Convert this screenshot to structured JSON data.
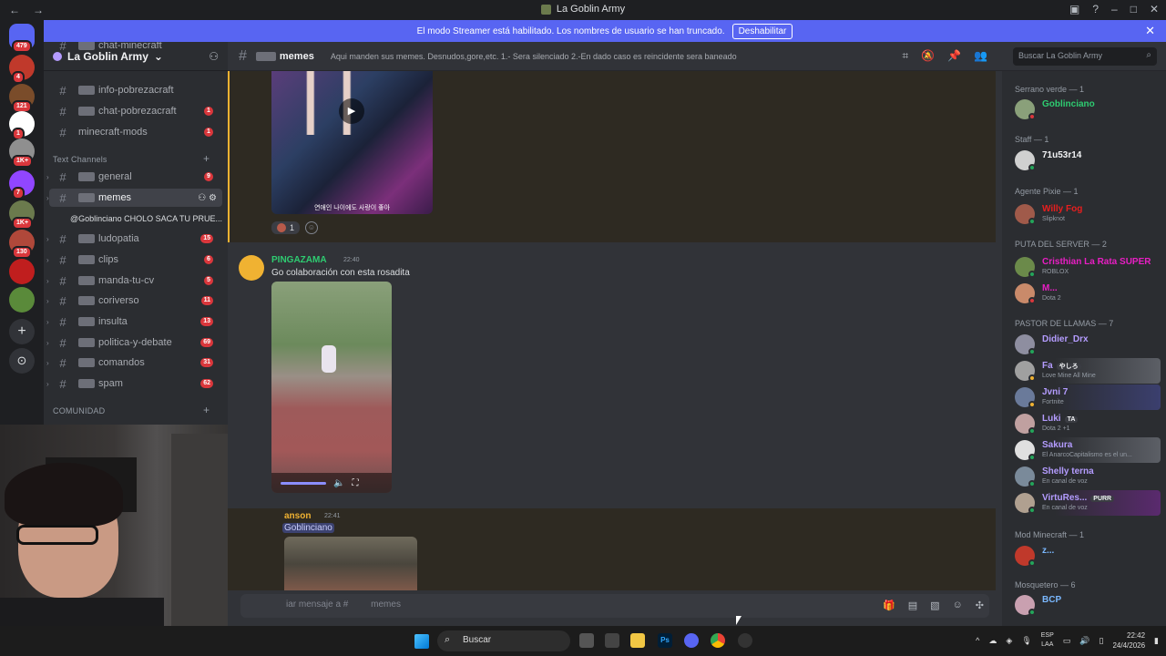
{
  "window": {
    "title": "La Goblin Army"
  },
  "servers": [
    {
      "badge": "479",
      "color": "#5865f2"
    },
    {
      "badge": "4",
      "color": "#c0392b"
    },
    {
      "badge": "121",
      "color": "#7a4c2a"
    },
    {
      "badge": "1",
      "color": "#ffffff"
    },
    {
      "badge": "1K+",
      "color": "#8f8f8f"
    },
    {
      "badge": "7",
      "color": "#9146ff"
    },
    {
      "badge": "1K+",
      "color": "#6b7a4d"
    },
    {
      "badge": "130",
      "color": "#b0483a"
    },
    {
      "badge": "",
      "color": "#c01e1e"
    },
    {
      "badge": "",
      "color": "#5a8a3a"
    }
  ],
  "banner": {
    "text": "El modo Streamer está habilitado. Los nombres de usuario se han truncado.",
    "button": "Deshabilitar"
  },
  "guild": {
    "name": "La Goblin Army"
  },
  "channels": {
    "top": [
      {
        "name": "chat-minecraft",
        "count": ""
      },
      {
        "name": "info-pobrezacraft",
        "count": ""
      },
      {
        "name": "chat-pobrezacraft",
        "count": "1"
      },
      {
        "name": "minecraft-mods",
        "count": "1"
      }
    ],
    "text_category": "Text Channels",
    "text": [
      {
        "name": "general",
        "count": "9"
      },
      {
        "name": "memes",
        "count": ""
      },
      {
        "name": "ludopatia",
        "count": "15"
      },
      {
        "name": "clips",
        "count": "6"
      },
      {
        "name": "manda-tu-cv",
        "count": "5"
      },
      {
        "name": "coriverso",
        "count": "11"
      },
      {
        "name": "insulta",
        "count": "13"
      },
      {
        "name": "politica-y-debate",
        "count": "69"
      },
      {
        "name": "comandos",
        "count": "31"
      },
      {
        "name": "spam",
        "count": "62"
      }
    ],
    "thread": "@Goblinciano CHOLO SACA TU PRUE...",
    "community_category": "COMUNIDAD"
  },
  "header": {
    "channel": "memes",
    "topic": "Aqui manden sus memes. Desnudos,gore,etc. 1.- Sera silenciado 2.-En dado caso es reincidente sera baneado",
    "search_placeholder": "Buscar La Goblin Army"
  },
  "messages": {
    "video_caption": "연애인 나이에도 사랑이 좋아",
    "reaction_count": "1",
    "msg2": {
      "author": "PINGAZAMA",
      "time": "22:40",
      "text": "Go colaboración con esta rosadita"
    },
    "msg3": {
      "author": "anson",
      "time": "22:41",
      "mention": "Goblinciano"
    }
  },
  "composer": {
    "placeholder": "iar mensaje a #",
    "channel": "memes"
  },
  "members": {
    "groups": [
      {
        "title": "Serrano verde — 1"
      },
      {
        "title": "Staff — 1"
      },
      {
        "title": "Agente Pixie — 1"
      },
      {
        "title": "PUTA DEL SERVER — 2"
      },
      {
        "title": "PASTOR DE LLAMAS — 7"
      },
      {
        "title": "Mod Minecraft — 1"
      },
      {
        "title": "Mosquetero — 6"
      }
    ],
    "list": [
      {
        "name": "Goblinciano",
        "sub": "",
        "color": "#2ecc71"
      },
      {
        "name": "71u53r14",
        "sub": "",
        "color": "#f2f3f5"
      },
      {
        "name": "Willy Fog",
        "sub": "Slipknot",
        "color": "#e91e1e"
      },
      {
        "name": "Cristhian La Rata SUPER",
        "sub": "ROBLOX",
        "color": "#e91ec4"
      },
      {
        "name": "M...",
        "sub": "Dota 2",
        "color": "#e91ec4"
      },
      {
        "name": "Didier_Drx",
        "sub": "",
        "color": "#b49cff"
      },
      {
        "name": "Fa",
        "sub": "Love Mine All Mine",
        "color": "#b49cff"
      },
      {
        "name": "Jvni 7",
        "sub": "Fortnite",
        "color": "#b49cff"
      },
      {
        "name": "Luki",
        "sub": "Dota 2 +1",
        "color": "#b49cff"
      },
      {
        "name": "Sakura",
        "sub": "El AnarcoCapitalismo es el un...",
        "color": "#b49cff"
      },
      {
        "name": "Shelly terna",
        "sub": "En canal de voz",
        "color": "#b49cff"
      },
      {
        "name": "VirtuRes...",
        "sub": "En canal de voz",
        "color": "#b49cff"
      },
      {
        "name": "z...",
        "sub": "",
        "color": "#7ab8ff"
      },
      {
        "name": "BCP",
        "sub": "",
        "color": "#7ab8ff"
      }
    ],
    "tag_fa": "やしろ",
    "tag_luki": "TA",
    "tag_virtu": "PURR"
  },
  "taskbar": {
    "search": "Buscar",
    "lang1": "ESP",
    "lang2": "LAA",
    "time": "22:42",
    "date": "24/4/2026"
  }
}
